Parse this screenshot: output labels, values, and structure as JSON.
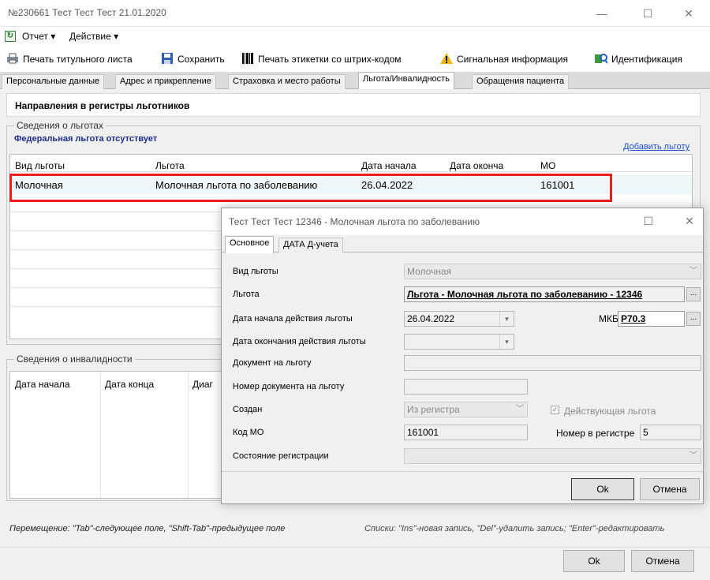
{
  "window": {
    "title": "№230661 Тест Тест Тест 21.01.2020",
    "minimize": "—",
    "maximize": "☐",
    "close": "✕"
  },
  "menu": {
    "report": "Отчет ▾",
    "action": "Действие ▾"
  },
  "toolbar": {
    "print_title": "Печать титульного листа",
    "save": "Сохранить",
    "print_barcode": "Печать этикетки со штрих-кодом",
    "signal_info": "Сигнальная информация",
    "identification": "Идентификация"
  },
  "tabs": [
    "Персональные данные",
    "Адрес и прикрепление",
    "Страховка и место работы",
    "Льгота/Инвалидность",
    "Обращения пациента"
  ],
  "section_title": "Направления в регистры льготников",
  "benefits": {
    "group_label": "Сведения о льготах",
    "federal_status": "Федеральная льгота отсутствует",
    "add_link": "Добавить льготу",
    "columns": [
      "Вид льготы",
      "Льгота",
      "Дата начала",
      "Дата оконча",
      "МО"
    ],
    "rows": [
      [
        "Молочная",
        "Молочная льгота по заболеванию",
        "26.04.2022",
        "",
        "161001"
      ]
    ]
  },
  "disability": {
    "group_label": "Сведения о инвалидности",
    "columns": [
      "Дата начала",
      "Дата конца",
      "Диаг"
    ]
  },
  "status": {
    "left": "Перемещение: \"Tab\"-следующее поле, \"Shift-Tab\"-предыдущее поле",
    "right": "Списки: \"Ins\"-новая запись, \"Del\"-удалить запись; \"Enter\"-редактировать"
  },
  "main_buttons": {
    "ok": "Ok",
    "cancel": "Отмена"
  },
  "dialog": {
    "title": "Тест Тест Тест 12346 - Молочная льгота по заболеванию",
    "maximize": "☐",
    "close": "✕",
    "tabs": [
      "Основное",
      "ДАТА Д-учета"
    ],
    "labels": {
      "kind": "Вид льготы",
      "benefit": "Льгота",
      "start": "Дата начала действия льготы",
      "end": "Дата окончания действия льготы",
      "doc": "Документ на льготу",
      "doc_number": "Номер документа на льготу",
      "created": "Создан",
      "mo_code": "Код МО",
      "reg_state": "Состояние регистрации",
      "mkb": "МКБ",
      "active": "Действующая льгота",
      "reg_number": "Номер в регистре"
    },
    "values": {
      "kind": "Молочная",
      "benefit": "Льгота - Молочная льгота по заболеванию - 12346",
      "start": "26.04.2022",
      "end": "",
      "doc": "",
      "doc_number": "",
      "created": "Из регистра",
      "mo_code": "161001",
      "reg_state": "",
      "mkb": "P70.3",
      "active_checked": true,
      "reg_number": "5"
    },
    "buttons": {
      "ok": "Ok",
      "cancel": "Отмена"
    }
  }
}
